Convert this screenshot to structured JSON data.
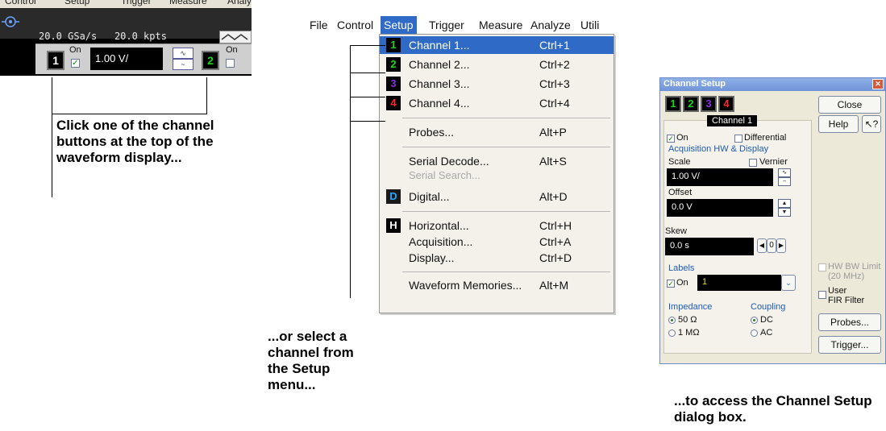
{
  "panel1": {
    "menu_items": [
      "Control",
      "Setup",
      "Trigger",
      "Measure",
      "Analy"
    ],
    "sample_rate": "20.0 GSa/s",
    "memory_depth": "20.0 kpts",
    "ch1_label": "1",
    "ch1_on": "On",
    "ch1_scale": "1.00 V/",
    "ch2_label": "2",
    "ch2_on": "On",
    "caption": "Click one of the channel buttons at the top of the waveform display..."
  },
  "panel2": {
    "menubar": [
      "File",
      "Control",
      "Setup",
      "Trigger",
      "Measure",
      "Analyze",
      "Utili"
    ],
    "active_menu": "Setup",
    "items": [
      {
        "icon": "1",
        "icon_color": "#1fd41f",
        "label": "Channel 1...",
        "shortcut": "Ctrl+1"
      },
      {
        "icon": "2",
        "icon_color": "#1fd41f",
        "label": "Channel 2...",
        "shortcut": "Ctrl+2"
      },
      {
        "icon": "3",
        "icon_color": "#8a2be2",
        "label": "Channel 3...",
        "shortcut": "Ctrl+3"
      },
      {
        "icon": "4",
        "icon_color": "#ff2a2a",
        "label": "Channel 4...",
        "shortcut": "Ctrl+4"
      },
      {
        "icon": "",
        "label": "Probes...",
        "shortcut": "Alt+P"
      },
      {
        "icon": "",
        "label": "Serial Decode...",
        "shortcut": "Alt+S"
      },
      {
        "icon": "",
        "label": "Serial Search...",
        "shortcut": ""
      },
      {
        "icon": "D",
        "icon_color": "#2aa6ff",
        "label": "Digital...",
        "shortcut": "Alt+D"
      },
      {
        "icon": "H",
        "icon_color": "#ffffff",
        "label": "Horizontal...",
        "shortcut": "Ctrl+H"
      },
      {
        "icon": "",
        "label": "Acquisition...",
        "shortcut": "Ctrl+A"
      },
      {
        "icon": "",
        "label": "Display...",
        "shortcut": "Ctrl+D"
      },
      {
        "icon": "",
        "label": "Waveform Memories...",
        "shortcut": "Alt+M"
      }
    ],
    "caption": "...or select a channel from the Setup menu..."
  },
  "panel3": {
    "title": "Channel Setup",
    "tabs": [
      "1",
      "2",
      "3",
      "4"
    ],
    "tab_colors": [
      "#1fd41f",
      "#1fd41f",
      "#8a2be2",
      "#ff2a2a"
    ],
    "selected_channel": "Channel 1",
    "on_label": "On",
    "differential_label": "Differential",
    "acq_group": "Acquisition HW & Display",
    "scale_label": "Scale",
    "vernier_label": "Vernier",
    "scale_value": "1.00 V/",
    "offset_label": "Offset",
    "offset_value": "0.0 V",
    "skew_label": "Skew",
    "skew_value": "0.0 s",
    "skew_step": "0",
    "labels_group": "Labels",
    "labels_on": "On",
    "label_value": "1",
    "impedance_label": "Impedance",
    "imp_50": "50 Ω",
    "imp_1m": "1 MΩ",
    "coupling_label": "Coupling",
    "coup_dc": "DC",
    "coup_ac": "AC",
    "close_button": "Close",
    "help_button": "Help",
    "hw_bw_limit": "HW BW Limit",
    "hw_bw_sub": "(20 MHz)",
    "user_label": "User",
    "fir_filter": "FIR Filter",
    "probes_button": "Probes...",
    "trigger_button": "Trigger...",
    "caption": "...to access the Channel Setup dialog box."
  }
}
